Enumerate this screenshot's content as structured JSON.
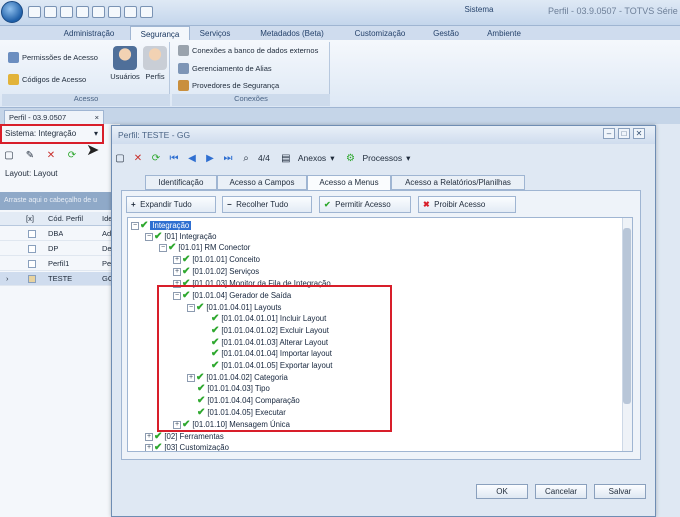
{
  "window": {
    "title": "Perfil - 03.9.0507 - TOTVS Série",
    "sistema_label": "Sistema"
  },
  "ribbon": {
    "tabs": [
      "Administração",
      "Segurança",
      "Serviços",
      "Metadados (Beta)",
      "Customização",
      "Gestão",
      "Ambiente"
    ],
    "acesso_group": {
      "label": "Acesso",
      "items": [
        "Permissões de Acesso",
        "Códigos de Acesso",
        "Usuários",
        "Perfis"
      ]
    },
    "conexoes_group": {
      "label": "Conexões",
      "items": [
        "Conexões a banco de dados externos",
        "Gerenciamento de Alias",
        "Provedores de Segurança"
      ]
    }
  },
  "doc_tab": {
    "label": "Perfil - 03.9.0507"
  },
  "left_panel": {
    "sistema_selector": "Sistema:  Integração",
    "layout_label": "Layout:  Layout",
    "group_hint": "Arraste aqui o cabeçalho de u",
    "columns": [
      "[x]",
      "Cód. Perfil",
      "Ide"
    ],
    "rows": [
      {
        "code": "DBA",
        "id": "Ad"
      },
      {
        "code": "DP",
        "id": "De"
      },
      {
        "code": "Perfil1",
        "id": "Pe"
      },
      {
        "code": "TESTE",
        "id": "GG"
      }
    ]
  },
  "dialog": {
    "title": "Perfil: TESTE - GG",
    "pager": "4/4",
    "anexos": "Anexos",
    "processos": "Processos",
    "tabs": [
      "Identificação",
      "Acesso a Campos",
      "Acesso a Menus",
      "Acesso a Relatórios/Planilhas"
    ],
    "buttons": {
      "expandir": "Expandir Tudo",
      "recolher": "Recolher Tudo",
      "permitir": "Permitir Acesso",
      "proibir": "Proibir Acesso"
    },
    "tree": [
      "Integração",
      "[01] Integração",
      "[01.01] RM Conector",
      "[01.01.01] Conceito",
      "[01.01.02] Serviços",
      "[01.01.03] Monitor da Fila de Integração",
      "[01.01.04] Gerador de  Saída",
      "[01.01.04.01] Layouts",
      "[01.01.04.01.01] Incluir Layout",
      "[01.01.04.01.02] Excluir Layout",
      "[01.01.04.01.03] Alterar Layout",
      "[01.01.04.01.04] Importar layout",
      "[01.01.04.01.05] Exportar layout",
      "[01.01.04.02] Categoria",
      "[01.01.04.03] Tipo",
      "[01.01.04.04] Comparação",
      "[01.01.04.05] Executar",
      "[01.01.10] Mensagem Única",
      "[02] Ferramentas",
      "[03] Customização"
    ],
    "footer": {
      "ok": "OK",
      "cancel": "Cancelar",
      "save": "Salvar"
    }
  },
  "colors": {
    "accent": "#2f6fd1",
    "highlight_box": "#d81e2a",
    "check": "#2ea82e",
    "ribbon": "#dde8f5"
  }
}
